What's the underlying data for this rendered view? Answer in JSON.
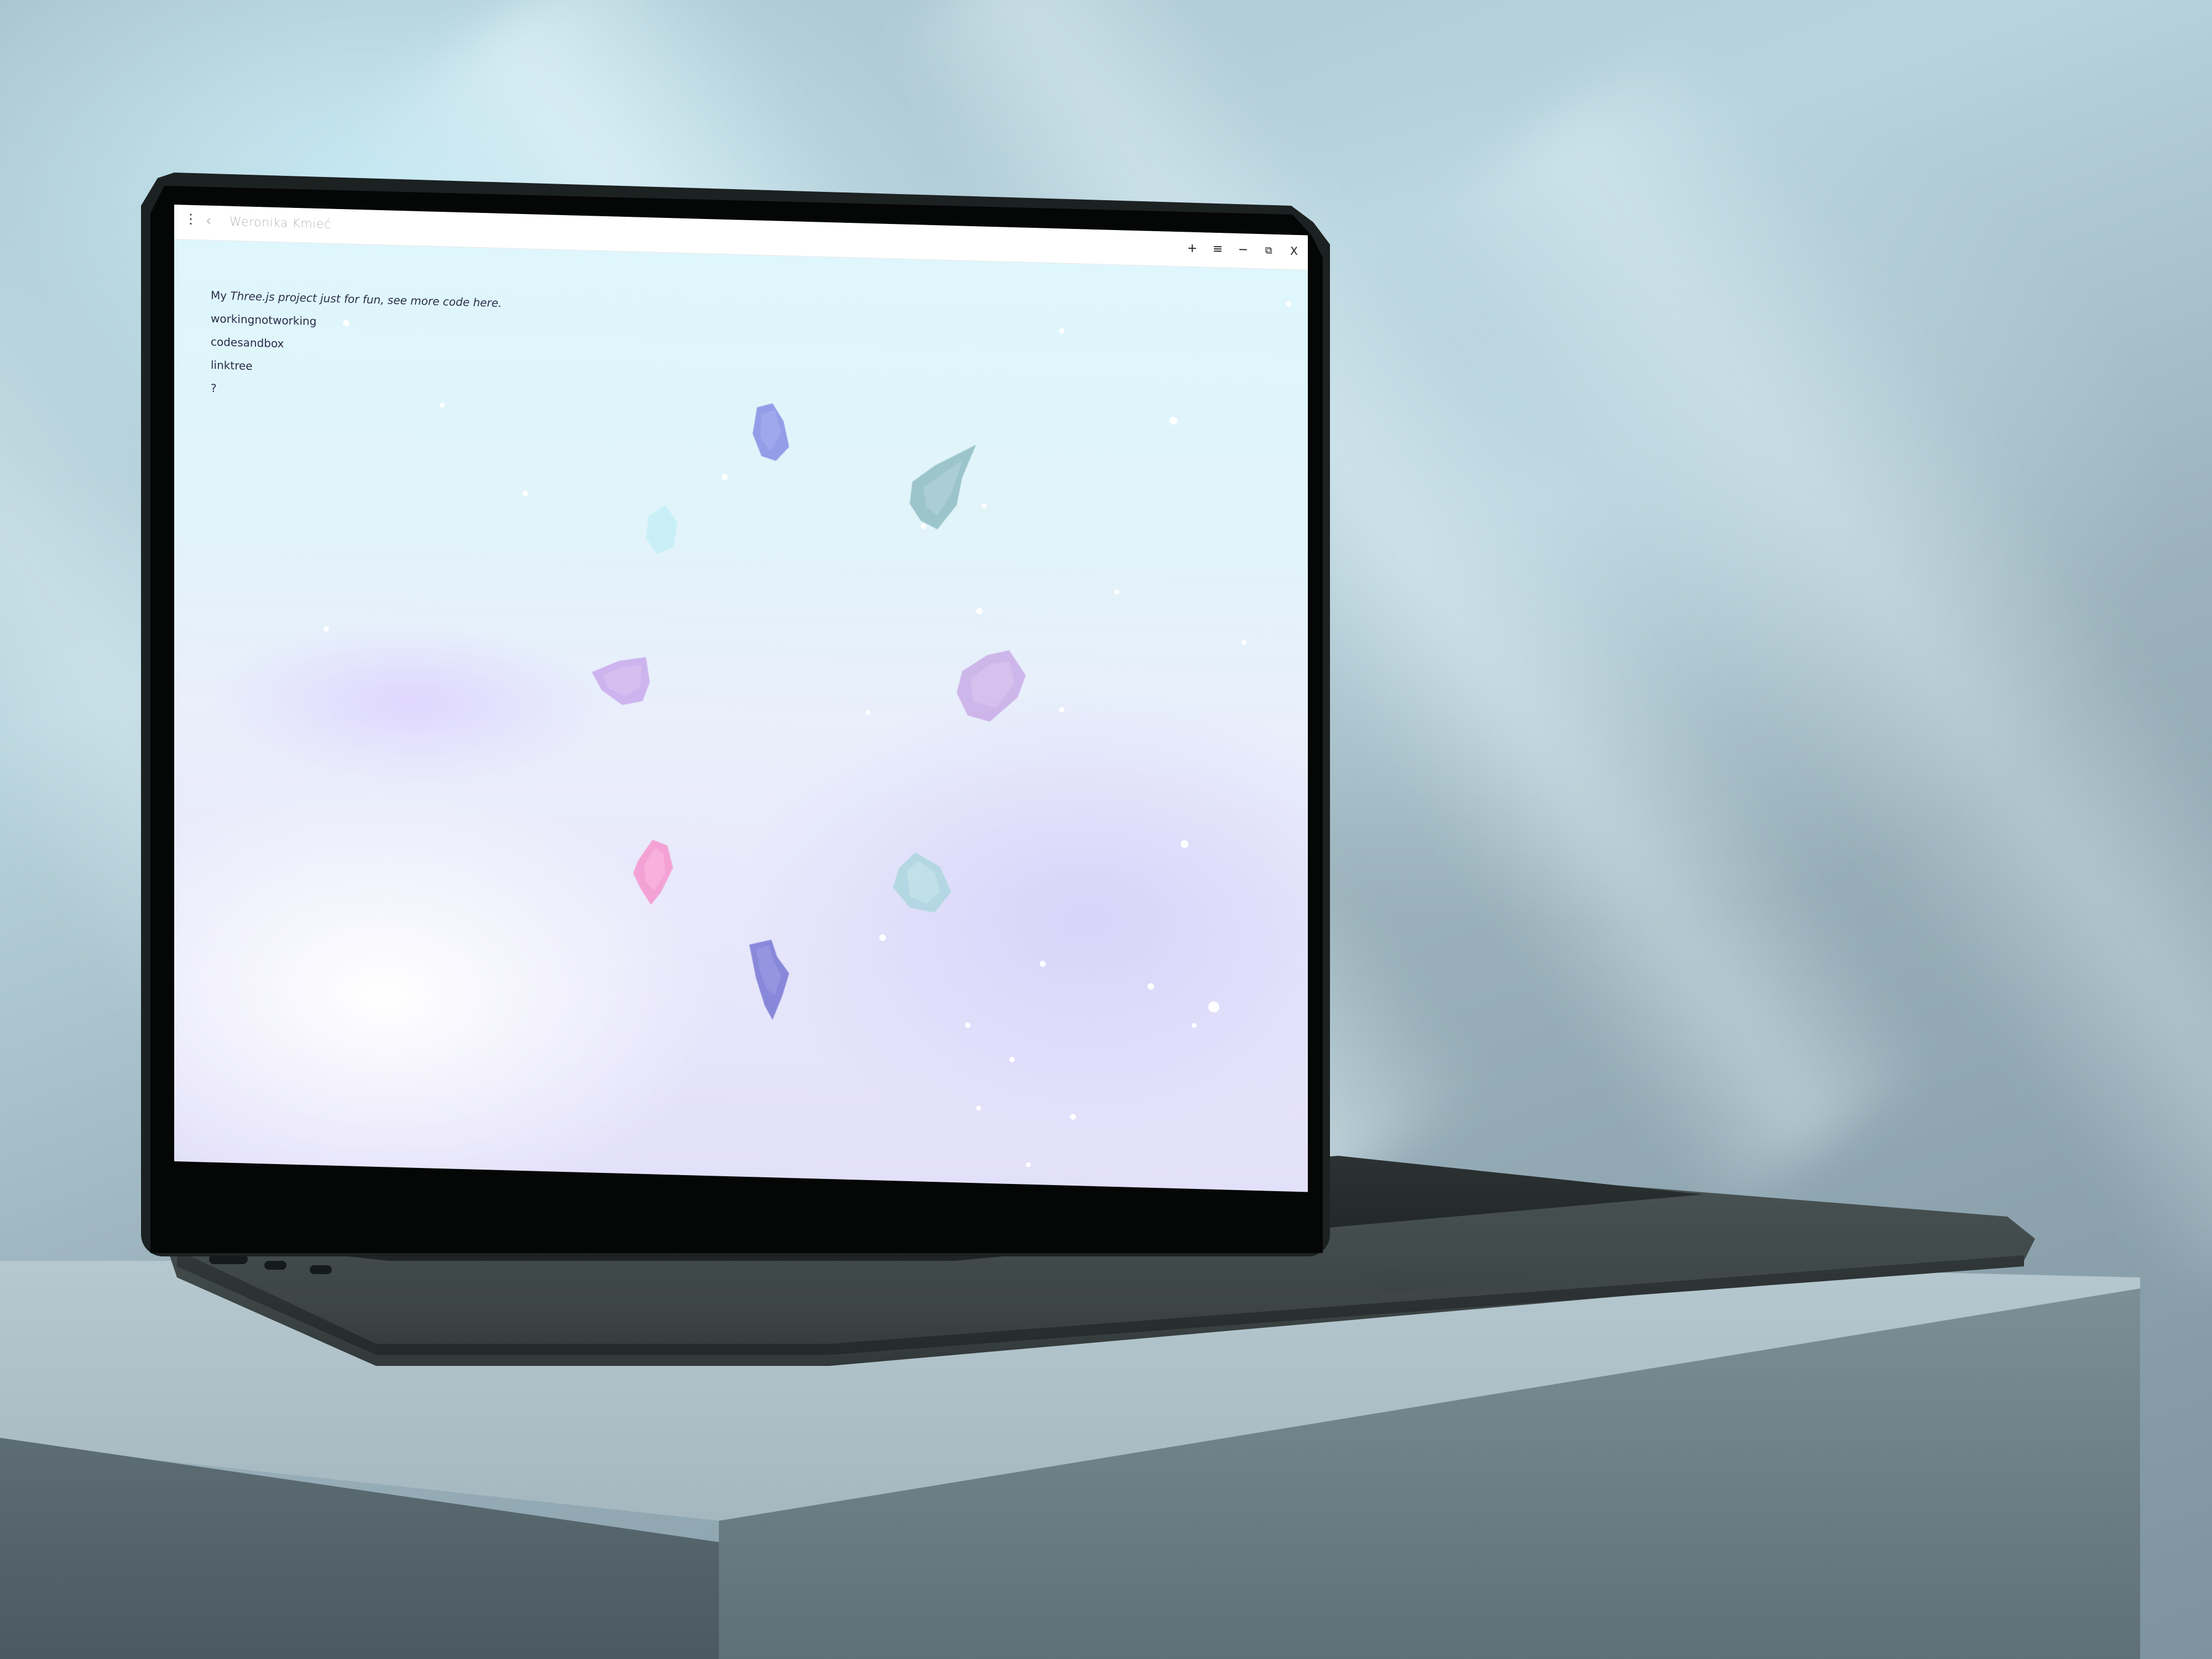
{
  "window": {
    "title": "Weronika Kmieć",
    "menu_icon": "kebab-menu-icon",
    "back_icon": "chevron-left-icon",
    "controls": {
      "new_tab": "+",
      "menu": "≡",
      "minimize": "−",
      "restore": "⧉",
      "close": "X"
    }
  },
  "content": {
    "intro_prefix": "My ",
    "intro_link": "Three.js project",
    "intro_suffix": " just for fun, see more code ",
    "intro_here": "here.",
    "links": [
      {
        "label": "workingnotworking"
      },
      {
        "label": "codesandbox"
      },
      {
        "label": "linktree"
      },
      {
        "label": "?"
      }
    ]
  },
  "scene": {
    "crystals": [
      {
        "name": "crystal-blue-top",
        "color": "#8b93e6"
      },
      {
        "name": "crystal-teal-right",
        "color": "#8fbcc3"
      },
      {
        "name": "crystal-cyan-faint",
        "color": "#bfeef4"
      },
      {
        "name": "crystal-lilac-left",
        "color": "#c9a9ec"
      },
      {
        "name": "crystal-lilac-right",
        "color": "#c7a8e6"
      },
      {
        "name": "crystal-pink",
        "color": "#f59ad0"
      },
      {
        "name": "crystal-teal-bottom",
        "color": "#a9d6dd"
      },
      {
        "name": "crystal-indigo-bottom",
        "color": "#7d7ed6"
      }
    ]
  },
  "colors": {
    "text": "#2b2d4a",
    "title_text": "#b4b8bc",
    "page_top": "#ddf7fc",
    "page_bottom": "#e3e0fa"
  }
}
